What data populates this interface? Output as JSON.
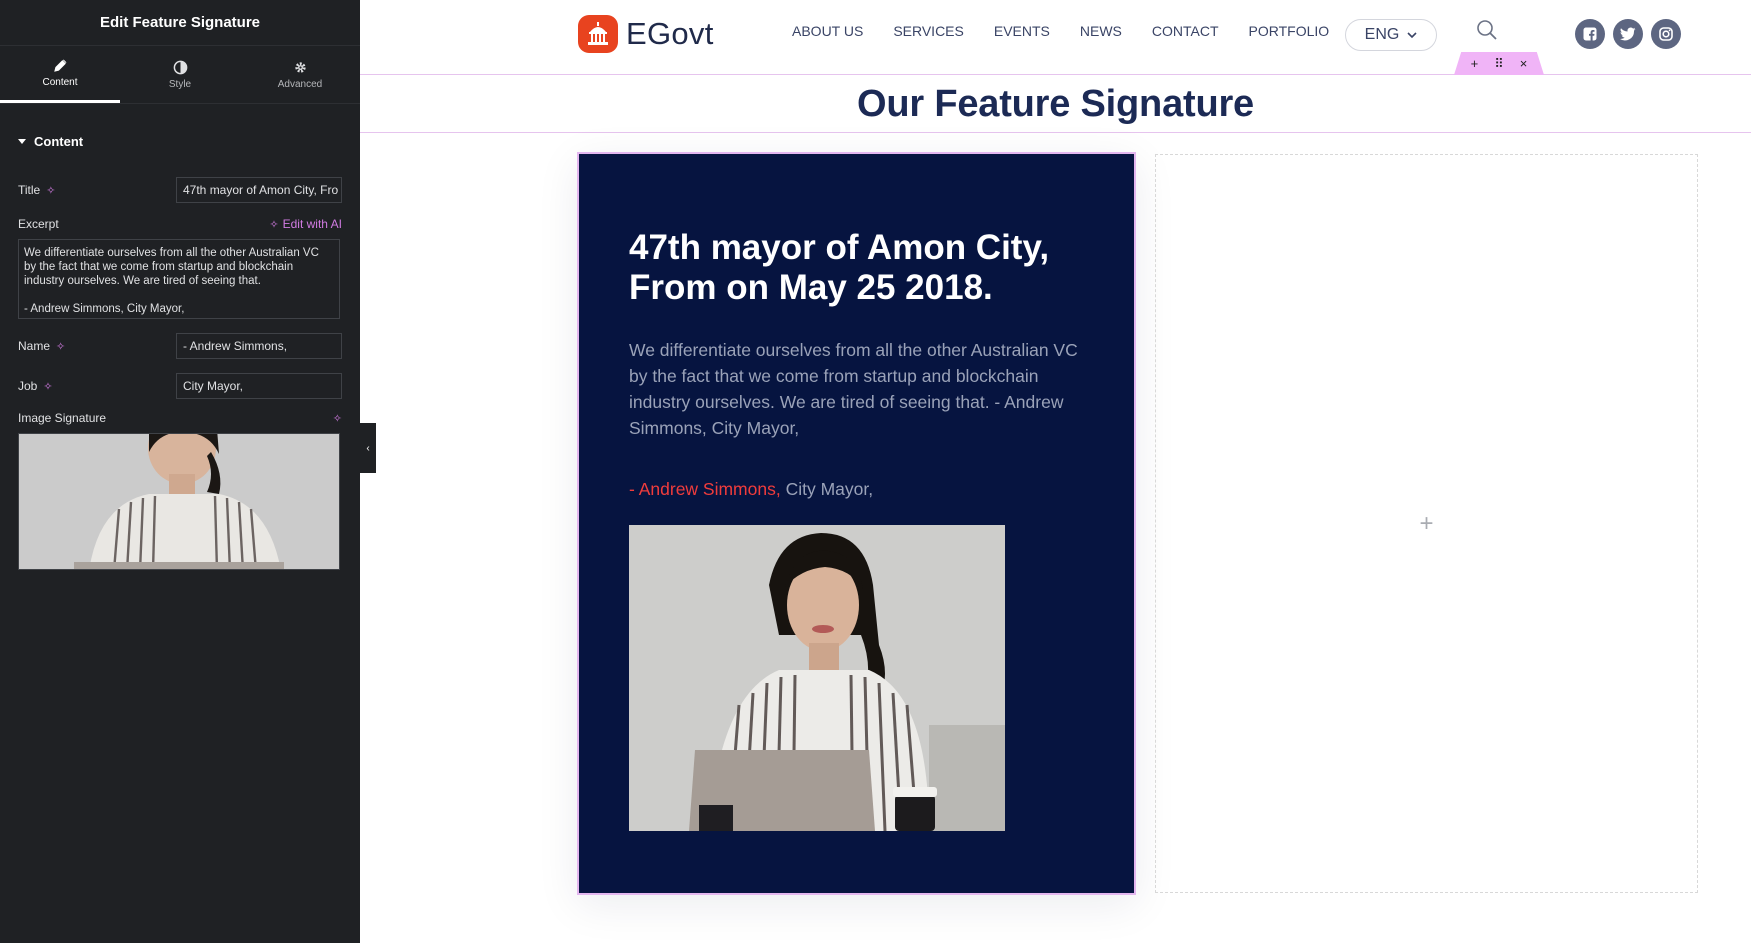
{
  "panel": {
    "header_title": "Edit Feature Signature",
    "tabs": [
      {
        "label": "Content",
        "icon": "pencil-icon",
        "active": true
      },
      {
        "label": "Style",
        "icon": "half-circle-icon",
        "active": false
      },
      {
        "label": "Advanced",
        "icon": "gear-icon",
        "active": false
      }
    ],
    "section_title": "Content",
    "fields": {
      "title_label": "Title",
      "title_value": "47th mayor of Amon City, Fro",
      "excerpt_label": "Excerpt",
      "edit_ai_label": "Edit with AI",
      "excerpt_value": "We differentiate ourselves from all the other Australian VC by the fact that we come from startup and blockchain industry ourselves. We are tired of seeing that.\n\n- Andrew Simmons, City Mayor,",
      "name_label": "Name",
      "name_value": "- Andrew Simmons,",
      "job_label": "Job",
      "job_value": "City Mayor,",
      "image_label": "Image Signature"
    },
    "collapse_glyph": "‹"
  },
  "header": {
    "logo_text": "EGovt",
    "nav": [
      "ABOUT US",
      "SERVICES",
      "EVENTS",
      "NEWS",
      "CONTACT",
      "PORTFOLIO"
    ],
    "language": "ENG",
    "socials": [
      "facebook-icon",
      "twitter-icon",
      "instagram-icon"
    ],
    "section_handle": [
      "+",
      "⠿",
      "×"
    ]
  },
  "main": {
    "page_title": "Our Feature Signature",
    "card": {
      "title": "47th mayor of Amon City, From on May 25 2018.",
      "excerpt": "We differentiate ourselves from all the other Australian VC by the fact that we come from startup and blockchain industry ourselves. We are tired of seeing that. - Andrew Simmons, City Mayor,",
      "name": "- Andrew Simmons,",
      "job": " City Mayor,"
    },
    "empty_column_glyph": "+"
  },
  "colors": {
    "panel_bg": "#1f2124",
    "card_bg": "#061440",
    "accent_red": "#f03c3c",
    "title_navy": "#1c2a55",
    "ai_pink": "#d17be2"
  }
}
